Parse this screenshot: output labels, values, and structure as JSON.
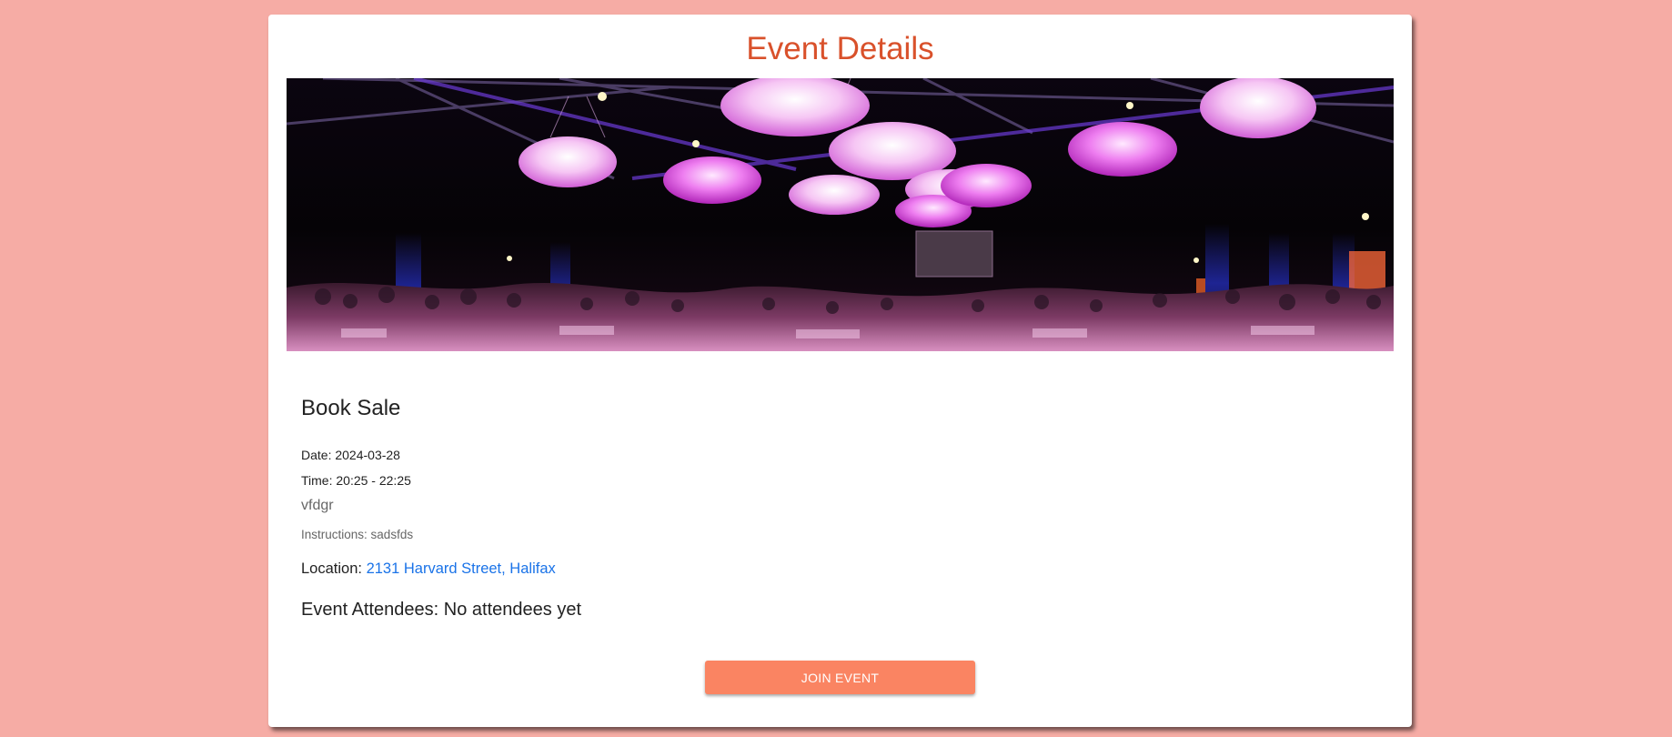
{
  "page": {
    "title": "Event Details",
    "background_color": "#f6aca5",
    "accent_color": "#d9512b"
  },
  "banner": {
    "icon": "event-hall-photo"
  },
  "event": {
    "name": "Book Sale",
    "date_label": "Date:",
    "date_value": "2024-03-28",
    "time_label": "Time:",
    "time_value": "20:25 - 22:25",
    "description": "vfdgr",
    "instructions_label": "Instructions:",
    "instructions_value": "sadsfds",
    "location_label": "Location:",
    "location_value": "2131 Harvard Street, Halifax",
    "attendees_label": "Event Attendees:",
    "attendees_value": "No attendees yet"
  },
  "actions": {
    "join_label": "JOIN EVENT",
    "join_color": "#fa8462",
    "link_color": "#1a73e8"
  }
}
